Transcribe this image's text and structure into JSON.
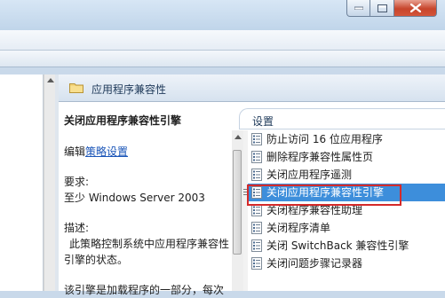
{
  "header": {
    "title": "应用程序兼容性"
  },
  "description": {
    "title": "关闭应用程序兼容性引擎",
    "edit_prefix": "编辑",
    "edit_link": "策略设置",
    "req_label": "要求:",
    "req_value": "至少 Windows Server 2003",
    "desc_label": "描述:",
    "desc_line1": "此策略控制系统中应用程序兼容性",
    "desc_line2": "引擎的状态。",
    "desc_line3": "该引擎是加载程序的一部分，每次"
  },
  "settings": {
    "tab_label": "设置",
    "items": [
      {
        "label": "防止访问 16 位应用程序"
      },
      {
        "label": "删除程序兼容性属性页"
      },
      {
        "label": "关闭应用程序遥测"
      },
      {
        "label": "关闭应用程序兼容性引擎",
        "selected": true
      },
      {
        "label": "关闭程序兼容性助理"
      },
      {
        "label": "关闭程序清单"
      },
      {
        "label": "关闭 SwitchBack 兼容性引擎"
      },
      {
        "label": "关闭问题步骤记录器"
      }
    ]
  },
  "icons": {
    "folder": "folder-icon",
    "policy": "policy-setting-icon",
    "minimize": "minimize-icon",
    "maximize": "maximize-icon",
    "close": "close-icon"
  },
  "colors": {
    "selection": "#3d8edb",
    "highlight_border": "#d52a2a",
    "link": "#1a55b8"
  }
}
